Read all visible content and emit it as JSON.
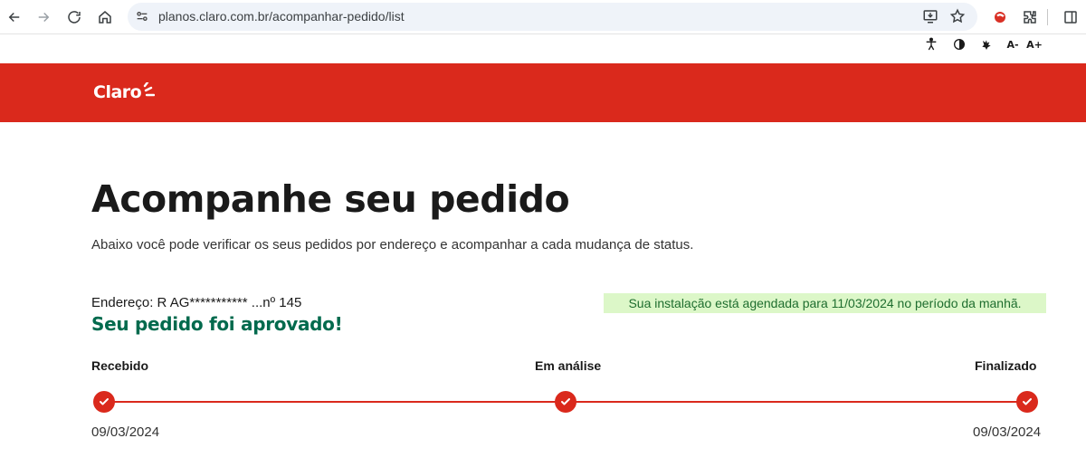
{
  "browser": {
    "url": "planos.claro.com.br/acompanhar-pedido/list",
    "icons": [
      "back-icon",
      "forward-icon",
      "reload-icon",
      "home-icon",
      "site-settings-icon",
      "install-app-icon",
      "bookmark-star-icon",
      "extension-red-icon",
      "extensions-puzzle-icon",
      "side-panel-icon"
    ]
  },
  "accessibility": {
    "font_decrease": "A-",
    "font_increase": "A+",
    "icons": [
      "accessibility-person-icon",
      "contrast-icon",
      "sign-language-icon"
    ]
  },
  "header": {
    "logo_text": "Claro",
    "brand_color": "#da291c"
  },
  "main": {
    "title": "Acompanhe seu pedido",
    "subtitle": "Abaixo você pode verificar os seus pedidos por endereço e acompanhar a cada mudança de status.",
    "address": "Endereço: R AG*********** ...nº 145",
    "status_title": "Seu pedido foi aprovado!",
    "schedule_message": "Sua instalação está agendada para 11/03/2024 no período da manhã.",
    "steps": [
      {
        "label": "Recebido",
        "date": "09/03/2024"
      },
      {
        "label": "Em análise",
        "date": ""
      },
      {
        "label": "Finalizado",
        "date": "09/03/2024"
      }
    ]
  }
}
